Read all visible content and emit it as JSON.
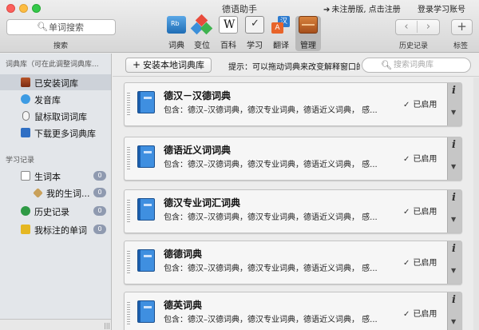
{
  "window": {
    "title": "德语助手",
    "register_text": "未注册版, 点击注册",
    "login_text": "登录学习账号"
  },
  "search": {
    "placeholder": "单词搜索",
    "label": "搜索"
  },
  "toolbar": {
    "tools": [
      {
        "label": "词典",
        "icon": "dictionary-icon"
      },
      {
        "label": "变位",
        "icon": "conjugation-icon"
      },
      {
        "label": "百科",
        "icon": "wikipedia-icon"
      },
      {
        "label": "学习",
        "icon": "study-icon"
      },
      {
        "label": "翻译",
        "icon": "translate-icon"
      },
      {
        "label": "管理",
        "icon": "manage-icon"
      }
    ],
    "history_label": "历史记录",
    "tag_label": "标签",
    "back_glyph": "‹",
    "forward_glyph": "›",
    "add_glyph": "+"
  },
  "sidebar": {
    "section_library": "词典库（可在此调整词典库...",
    "library_items": [
      {
        "label": "已安装词库",
        "icon": "installed-library-icon"
      },
      {
        "label": "发音库",
        "icon": "pronunciation-icon"
      },
      {
        "label": "鼠标取词词库",
        "icon": "mouse-icon"
      },
      {
        "label": "下载更多词典库",
        "icon": "download-icon"
      }
    ],
    "section_study": "学习记录",
    "study_items": [
      {
        "label": "生词本",
        "badge": "0",
        "icon": "vocabulary-icon"
      },
      {
        "label": "我的生词...",
        "badge": "0",
        "icon": "tag-icon"
      },
      {
        "label": "历史记录",
        "badge": "0",
        "icon": "history-icon"
      },
      {
        "label": "我标注的单词",
        "badge": "0",
        "icon": "star-icon"
      }
    ]
  },
  "main": {
    "install_button": "安装本地词典库",
    "hint": "提示：可以拖动词典来改变解释窗口的",
    "library_search_placeholder": "搜索词典库",
    "cards": [
      {
        "title": "德汉－汉德词典",
        "desc": "包含：德汉–汉德词典，德汉专业词典，德语近义词典， 感...",
        "status": "已启用"
      },
      {
        "title": "德语近义词词典",
        "desc": "包含：德汉–汉德词典，德汉专业词典，德语近义词典， 感...",
        "status": "已启用"
      },
      {
        "title": "德汉专业词汇词典",
        "desc": "包含：德汉–汉德词典，德汉专业词典，德语近义词典， 感...",
        "status": "已启用"
      },
      {
        "title": "德德词典",
        "desc": "包含：德汉–汉德词典，德汉专业词典，德语近义词典， 感...",
        "status": "已启用"
      },
      {
        "title": "德英词典",
        "desc": "包含：德汉–汉德词典，德汉专业词典，德语近义词典， 感...",
        "status": "已启用"
      }
    ]
  }
}
